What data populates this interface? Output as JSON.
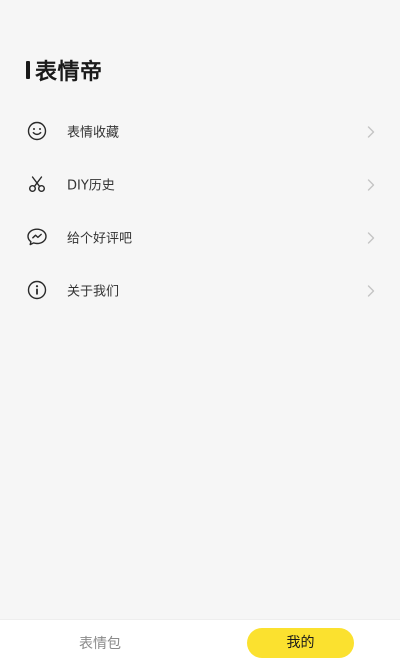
{
  "app": {
    "title": "表情帝"
  },
  "menu": {
    "items": [
      {
        "label": "表情收藏",
        "icon": "smiley-face-icon"
      },
      {
        "label": "DIY历史",
        "icon": "scissors-icon"
      },
      {
        "label": "给个好评吧",
        "icon": "chat-bubble-icon"
      },
      {
        "label": "关于我们",
        "icon": "info-icon"
      }
    ]
  },
  "tabbar": {
    "tabs": [
      {
        "label": "表情包",
        "active": false
      },
      {
        "label": "我的",
        "active": true
      }
    ]
  },
  "colors": {
    "background": "#f6f6f6",
    "accent": "#fbe12f",
    "text": "#333333",
    "muted": "#8a8a8a",
    "chevron": "#c4c4c4"
  }
}
